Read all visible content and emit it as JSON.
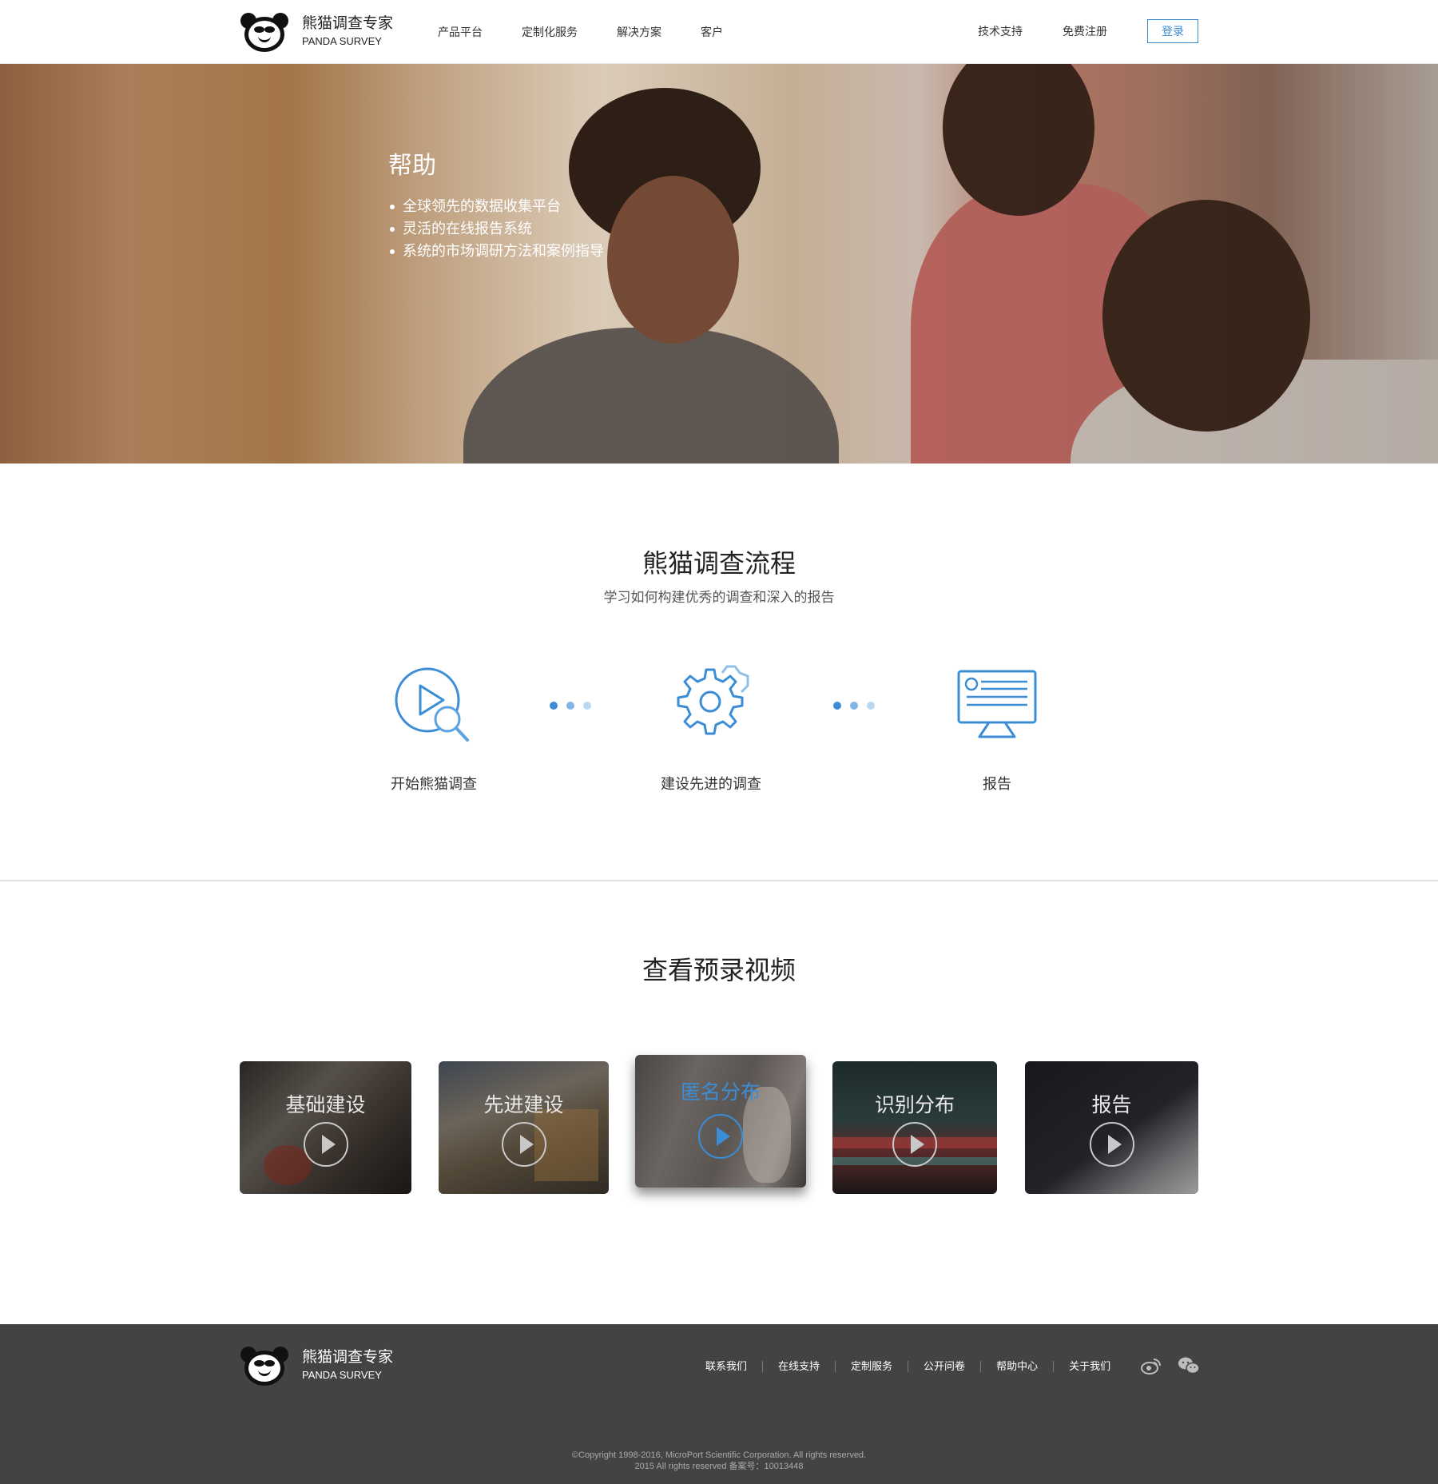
{
  "brand": {
    "name_cn": "熊猫调查专家",
    "name_en": "PANDA SURVEY"
  },
  "nav": {
    "items": [
      "产品平台",
      "定制化服务",
      "解决方案",
      "客户"
    ],
    "right": [
      "技术支持",
      "免费注册"
    ],
    "login": "登录"
  },
  "hero": {
    "title": "帮助",
    "bullets": [
      "全球领先的数据收集平台",
      "灵活的在线报告系统",
      "系统的市场调研方法和案例指导"
    ]
  },
  "process": {
    "title": "熊猫调查流程",
    "subtitle": "学习如何构建优秀的调查和深入的报告",
    "steps": [
      {
        "label": "开始熊猫调查",
        "icon": "play-search-icon"
      },
      {
        "label": "建设先进的调查",
        "icon": "gear-icon"
      },
      {
        "label": "报告",
        "icon": "monitor-report-icon"
      }
    ]
  },
  "videos": {
    "title": "查看预录视频",
    "items": [
      {
        "title": "基础建设",
        "active": false
      },
      {
        "title": "先进建设",
        "active": false
      },
      {
        "title": "匿名分布",
        "active": true
      },
      {
        "title": "识别分布",
        "active": false
      },
      {
        "title": "报告",
        "active": false
      }
    ]
  },
  "footer": {
    "links": [
      "联系我们",
      "在线支持",
      "定制服务",
      "公开问卷",
      "帮助中心",
      "关于我们"
    ],
    "social": [
      "weibo-icon",
      "wechat-icon"
    ],
    "copyright": "©Copyright 1998-2016, MicroPort Scientific Corporation. All rights reserved.",
    "icp": "2015 All rights reserved 备案号：10013448"
  },
  "colors": {
    "accent": "#3b8dd6",
    "footer_bg": "#434343"
  }
}
